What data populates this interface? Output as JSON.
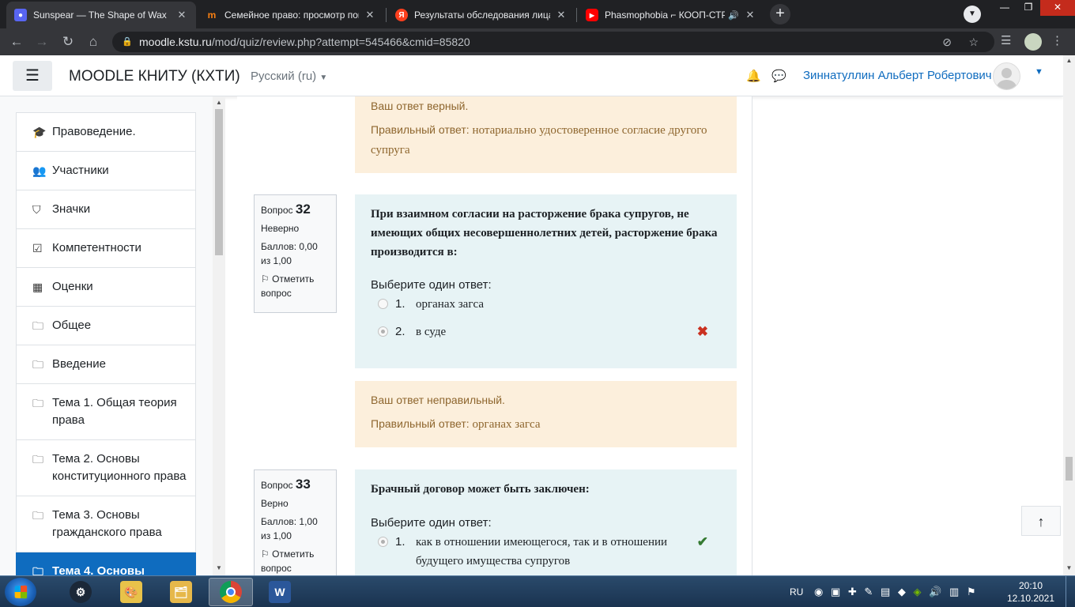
{
  "browser": {
    "tabs": [
      {
        "title": "Sunspear — The Shape of Wax",
        "favicon": "discord-icon",
        "active": true
      },
      {
        "title": "Семейное право: просмотр попытки",
        "favicon": "moodle-icon",
        "active": false
      },
      {
        "title": "Результаты обследования лица",
        "favicon": "yandex-icon",
        "active": false
      },
      {
        "title": "Phasmophobia ⌐ КООП-СТРИМ",
        "favicon": "youtube-icon",
        "active": false
      }
    ],
    "url_host": "moodle.kstu.ru",
    "url_path": "/mod/quiz/review.php?attempt=545466&cmid=85820"
  },
  "header": {
    "site_name": "MOODLE КНИТУ (КХТИ)",
    "language": "Русский (ru)",
    "user_name": "Зиннатуллин Альберт Робертович"
  },
  "nav": {
    "items": [
      {
        "label": "Правоведение.",
        "icon": "graduation-cap-icon"
      },
      {
        "label": "Участники",
        "icon": "users-icon"
      },
      {
        "label": "Значки",
        "icon": "shield-icon"
      },
      {
        "label": "Компетентности",
        "icon": "checkbox-icon"
      },
      {
        "label": "Оценки",
        "icon": "table-icon"
      },
      {
        "label": "Общее",
        "icon": "folder-icon"
      },
      {
        "label": "Введение",
        "icon": "folder-icon"
      },
      {
        "label": "Тема 1. Общая теория права",
        "icon": "folder-icon"
      },
      {
        "label": "Тема 2. Основы конституционного права",
        "icon": "folder-icon"
      },
      {
        "label": "Тема 3. Основы гражданского права",
        "icon": "folder-icon"
      },
      {
        "label": "Тема 4. Основы",
        "icon": "folder-icon",
        "active": true
      }
    ]
  },
  "feedback_top": {
    "verdict": "Ваш ответ верный.",
    "right_prefix": "Правильный ответ: ",
    "right_answer": "нотариально удостоверенное согласие другого супруга"
  },
  "q32": {
    "label": "Вопрос",
    "number": "32",
    "state": "Неверно",
    "grade": "Баллов: 0,00 из 1,00",
    "flag": "Отметить вопрос",
    "text": "При взаимном согласии на расторжение брака супругов, не имеющих общих несовершеннолетних детей, расторжение брака производится в:",
    "prompt": "Выберите один ответ:",
    "options": [
      {
        "num": "1.",
        "text": "органах загса",
        "selected": false
      },
      {
        "num": "2.",
        "text": "в суде",
        "selected": true,
        "mark": "incorrect"
      }
    ],
    "feedback": {
      "verdict": "Ваш ответ неправильный.",
      "right_prefix": "Правильный ответ: ",
      "right_answer": "органах загса"
    }
  },
  "q33": {
    "label": "Вопрос",
    "number": "33",
    "state": "Верно",
    "grade": "Баллов: 1,00 из 1,00",
    "flag": "Отметить вопрос",
    "text": "Брачный договор может быть заключен:",
    "prompt": "Выберите один ответ:",
    "options": [
      {
        "num": "1.",
        "text": "как в отношении имеющегося, так и в отношении будущего имущества супругов",
        "selected": true,
        "mark": "correct"
      }
    ]
  },
  "taskbar": {
    "lang": "RU",
    "time": "20:10",
    "date": "12.10.2021"
  },
  "colors": {
    "brand": "#0f6cbf",
    "feedback_bg": "#fcefdc",
    "question_bg": "#e7f3f5",
    "incorrect": "#ca3120",
    "correct": "#357a32"
  }
}
